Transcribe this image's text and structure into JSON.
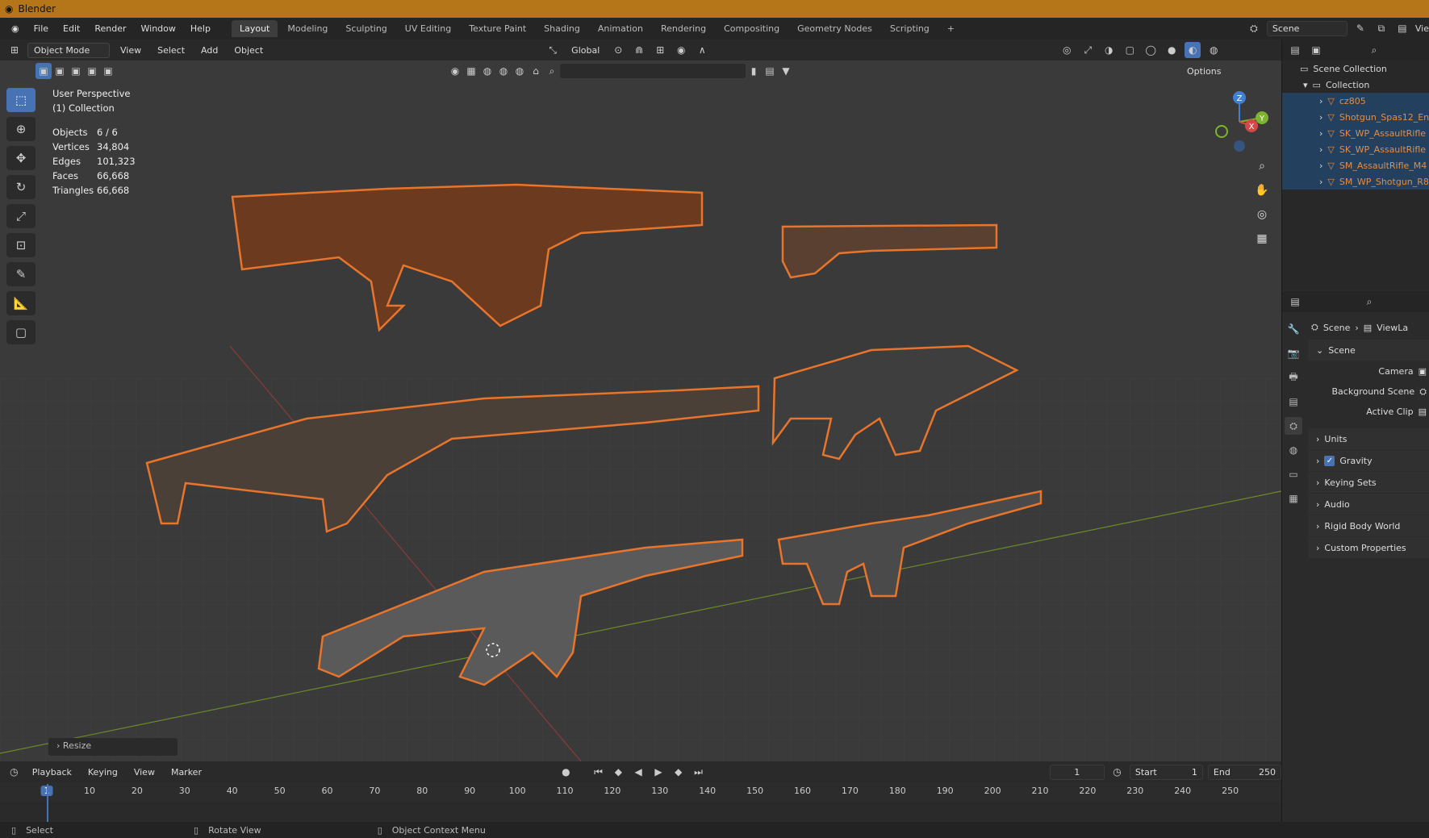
{
  "titlebar": {
    "app": "Blender"
  },
  "menu": [
    "File",
    "Edit",
    "Render",
    "Window",
    "Help"
  ],
  "workspaces": [
    "Layout",
    "Modeling",
    "Sculpting",
    "UV Editing",
    "Texture Paint",
    "Shading",
    "Animation",
    "Rendering",
    "Compositing",
    "Geometry Nodes",
    "Scripting"
  ],
  "scene": {
    "name": "Scene",
    "view": "Vie"
  },
  "viewport_header": {
    "mode": "Object Mode",
    "menus": [
      "View",
      "Select",
      "Add",
      "Object"
    ],
    "transform": "Global",
    "options": "Options"
  },
  "overlay": {
    "perspective": "User Perspective",
    "collection": "(1) Collection"
  },
  "stats": [
    {
      "key": "Objects",
      "value": "6 / 6"
    },
    {
      "key": "Vertices",
      "value": "34,804"
    },
    {
      "key": "Edges",
      "value": "101,323"
    },
    {
      "key": "Faces",
      "value": "66,668"
    },
    {
      "key": "Triangles",
      "value": "66,668"
    }
  ],
  "gizmo": {
    "z": "Z",
    "y": "Y",
    "x": "X"
  },
  "resize": "Resize",
  "outliner": {
    "root": "Scene Collection",
    "collection": "Collection",
    "items": [
      "cz805",
      "Shotgun_Spas12_En",
      "SK_WP_AssaultRifle",
      "SK_WP_AssaultRifle",
      "SM_AssaultRifle_M4",
      "SM_WP_Shotgun_R8"
    ]
  },
  "properties": {
    "breadcrumb": [
      "Scene",
      "ViewLa"
    ],
    "section": "Scene",
    "fields": [
      "Camera",
      "Background Scene",
      "Active Clip"
    ],
    "collapsed": [
      "Units",
      "Gravity",
      "Keying Sets",
      "Audio",
      "Rigid Body World",
      "Custom Properties"
    ]
  },
  "timeline": {
    "menus": [
      "Playback",
      "Keying",
      "View",
      "Marker"
    ],
    "current_frame": "1",
    "start_label": "Start",
    "start": "1",
    "end_label": "End",
    "end": "250",
    "ticks": [
      "1",
      "10",
      "20",
      "30",
      "40",
      "50",
      "60",
      "70",
      "80",
      "90",
      "100",
      "110",
      "120",
      "130",
      "140",
      "150",
      "160",
      "170",
      "180",
      "190",
      "200",
      "210",
      "220",
      "230",
      "240",
      "250"
    ]
  },
  "statusbar": {
    "select": "Select",
    "rotate": "Rotate View",
    "context": "Object Context Menu"
  }
}
